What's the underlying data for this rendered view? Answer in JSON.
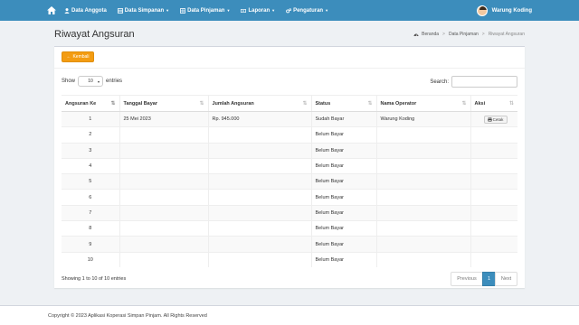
{
  "navbar": {
    "items": [
      {
        "label": "Data Anggota",
        "icon": "user-icon",
        "caret": false
      },
      {
        "label": "Data Simpanan",
        "icon": "ledger-icon",
        "caret": true
      },
      {
        "label": "Data Pinjaman",
        "icon": "table-icon",
        "caret": true
      },
      {
        "label": "Laporan",
        "icon": "money-icon",
        "caret": true
      },
      {
        "label": "Pengaturan",
        "icon": "cogs-icon",
        "caret": true
      }
    ],
    "user": "Warung Koding",
    "colors": {
      "brand": "#3c8dbc"
    }
  },
  "header": {
    "title": "Riwayat Angsuran",
    "breadcrumb": [
      "Beranda",
      "Data Pinjaman",
      "Riwayat Angsuran"
    ]
  },
  "toolbar": {
    "back_label": "Kembali",
    "back_color": "#f39c12"
  },
  "table_controls": {
    "show_label": "Show",
    "entries_value": "10",
    "entries_label": "entries",
    "search_label": "Search:",
    "search_value": ""
  },
  "table": {
    "columns": [
      "Angsuran Ke",
      "Tanggal Bayar",
      "Jumlah Angsuran",
      "Status",
      "Nama Operator",
      "Aksi"
    ],
    "rows": [
      {
        "no": "1",
        "tanggal": "25 Mei 2023",
        "jumlah": "Rp. 945.000",
        "status": "Sudah Bayar",
        "operator": "Warung Koding",
        "aksi": "Cetak"
      },
      {
        "no": "2",
        "tanggal": "",
        "jumlah": "",
        "status": "Belum Bayar",
        "operator": "",
        "aksi": ""
      },
      {
        "no": "3",
        "tanggal": "",
        "jumlah": "",
        "status": "Belum Bayar",
        "operator": "",
        "aksi": ""
      },
      {
        "no": "4",
        "tanggal": "",
        "jumlah": "",
        "status": "Belum Bayar",
        "operator": "",
        "aksi": ""
      },
      {
        "no": "5",
        "tanggal": "",
        "jumlah": "",
        "status": "Belum Bayar",
        "operator": "",
        "aksi": ""
      },
      {
        "no": "6",
        "tanggal": "",
        "jumlah": "",
        "status": "Belum Bayar",
        "operator": "",
        "aksi": ""
      },
      {
        "no": "7",
        "tanggal": "",
        "jumlah": "",
        "status": "Belum Bayar",
        "operator": "",
        "aksi": ""
      },
      {
        "no": "8",
        "tanggal": "",
        "jumlah": "",
        "status": "Belum Bayar",
        "operator": "",
        "aksi": ""
      },
      {
        "no": "9",
        "tanggal": "",
        "jumlah": "",
        "status": "Belum Bayar",
        "operator": "",
        "aksi": ""
      },
      {
        "no": "10",
        "tanggal": "",
        "jumlah": "",
        "status": "Belum Bayar",
        "operator": "",
        "aksi": ""
      }
    ]
  },
  "pagination": {
    "info": "Showing 1 to 10 of 10 entries",
    "previous": "Previous",
    "current": "1",
    "next": "Next"
  },
  "footer": {
    "text": "Copyright © 2023 Aplikasi Koperasi Simpan Pinjam. All Rights Reserved"
  }
}
